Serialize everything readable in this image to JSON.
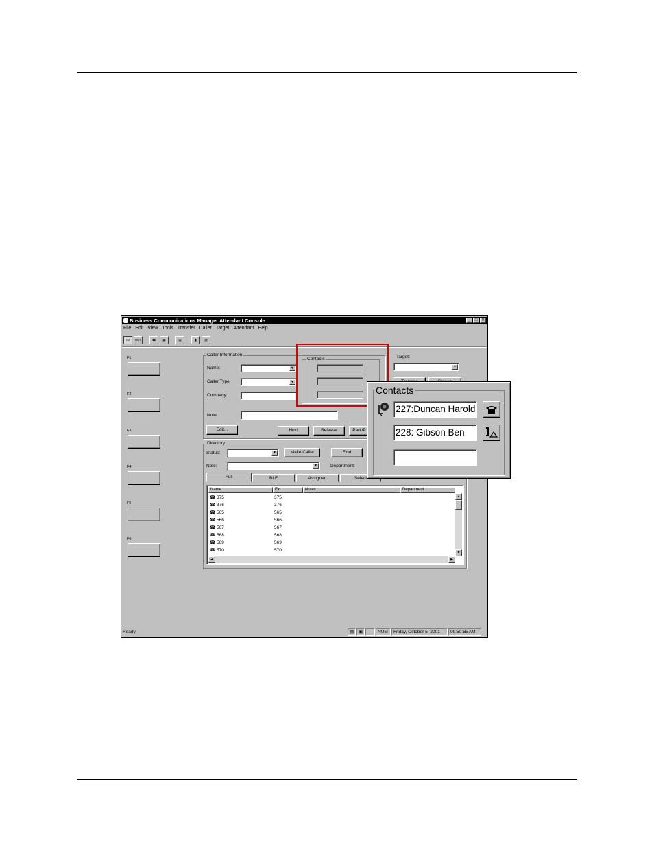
{
  "app": {
    "title": "Business Communications Manager Attendant Console",
    "window_buttons": [
      "_",
      "□",
      "×"
    ],
    "menu": [
      "File",
      "Edit",
      "View",
      "Tools",
      "Transfer",
      "Caller",
      "Target",
      "Attendant",
      "Help"
    ],
    "toolbar": {
      "in": "IN",
      "out": "OUT"
    },
    "fkeys": [
      "F1",
      "F2",
      "F3",
      "F4",
      "F5",
      "F6"
    ],
    "caller_info": {
      "group_label": "Caller Information",
      "name_label": "Name:",
      "caller_type_label": "Caller Type:",
      "company_label": "Company:",
      "note_label": "Note:",
      "edit_button": "Edit...",
      "hold_button": "Hold",
      "release_button": "Release",
      "park_button": "Park/P"
    },
    "contacts_label": "Contacts",
    "target": {
      "label": "Target:",
      "transfer_button": "Transfer",
      "screen_button": "Screen"
    },
    "directory": {
      "group_label": "Directory",
      "status_label": "Status:",
      "note_label": "Note:",
      "make_caller_button": "Make Caller",
      "find_button": "Find",
      "department_label": "Department:",
      "tabs": [
        "Full",
        "BLF",
        "Assigned",
        "Select"
      ],
      "columns": [
        "Name",
        "Ext",
        "Notes",
        "Department"
      ],
      "rows": [
        {
          "name": "375",
          "ext": "375"
        },
        {
          "name": "376",
          "ext": "376"
        },
        {
          "name": "565",
          "ext": "565"
        },
        {
          "name": "566",
          "ext": "566"
        },
        {
          "name": "567",
          "ext": "567"
        },
        {
          "name": "568",
          "ext": "568"
        },
        {
          "name": "569",
          "ext": "569"
        },
        {
          "name": "570",
          "ext": "570"
        }
      ]
    },
    "statusbar": {
      "ready": "Ready",
      "num": "NUM",
      "date": "Friday, October 5, 2001",
      "time": "09:50:55 AM"
    }
  },
  "zoom": {
    "label": "Contacts",
    "contact1": "227:Duncan Harold",
    "contact2": "228: Gibson Ben",
    "contact3": ""
  },
  "colors": {
    "highlight": "#e00000",
    "window_face": "#c0c0c0",
    "title_bar": "#000000"
  },
  "icons": [
    "phone-icon",
    "busy-phone-icon",
    "handset-off-hook-icon",
    "contact-status-icon"
  ]
}
